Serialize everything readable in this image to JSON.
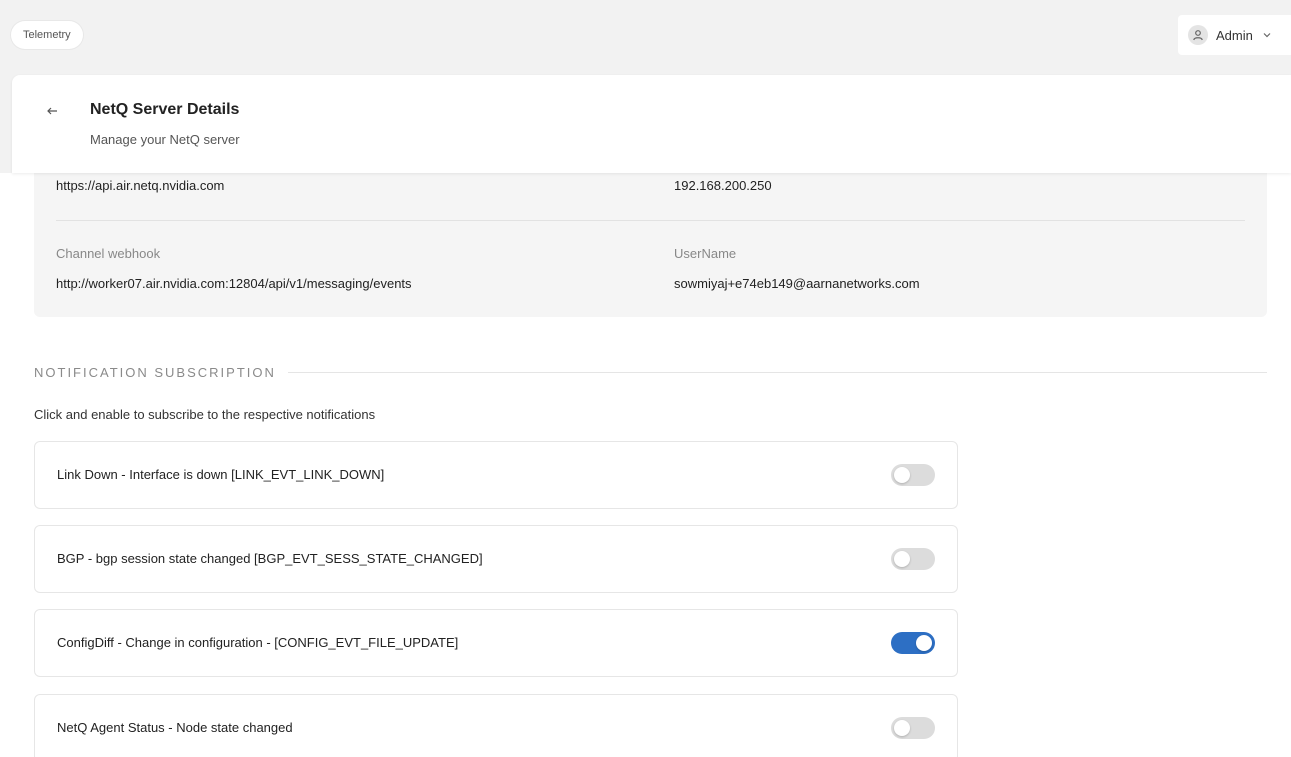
{
  "breadcrumb": {
    "label": "Telemetry"
  },
  "user_menu": {
    "label": "Admin"
  },
  "header": {
    "title": "NetQ Server Details",
    "subtitle": "Manage your NetQ server"
  },
  "details": {
    "server_url": "https://api.air.netq.nvidia.com",
    "server_ip": "192.168.200.250",
    "channel_webhook_label": "Channel webhook",
    "channel_webhook_value": "http://worker07.air.nvidia.com:12804/api/v1/messaging/events",
    "username_label": "UserName",
    "username_value": "sowmiyaj+e74eb149@aarnanetworks.com"
  },
  "notifications": {
    "heading": "NOTIFICATION SUBSCRIPTION",
    "description": "Click and enable to subscribe to the respective notifications",
    "items": [
      {
        "label": "Link Down - Interface is down [LINK_EVT_LINK_DOWN]",
        "enabled": false
      },
      {
        "label": "BGP - bgp session state changed [BGP_EVT_SESS_STATE_CHANGED]",
        "enabled": false
      },
      {
        "label": "ConfigDiff - Change in configuration - [CONFIG_EVT_FILE_UPDATE]",
        "enabled": true
      },
      {
        "label": "NetQ Agent Status - Node state changed",
        "enabled": false
      }
    ]
  },
  "colors": {
    "toggle_on": "#2d6fc4",
    "toggle_off": "#dcdcdc"
  }
}
